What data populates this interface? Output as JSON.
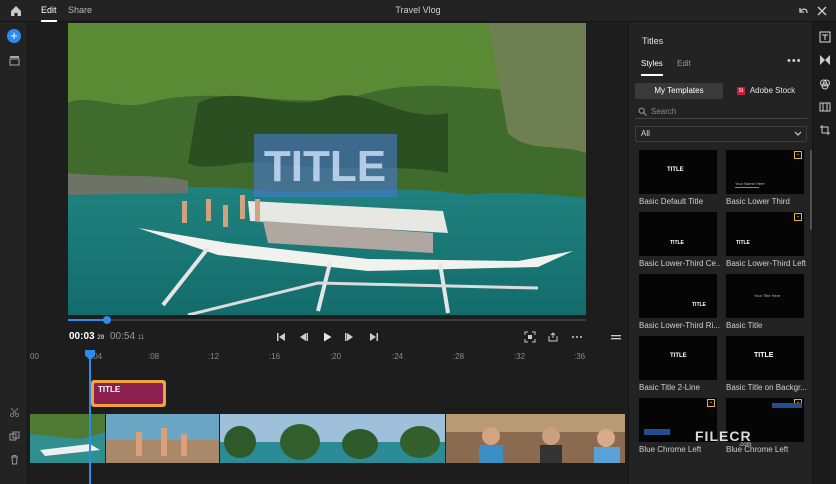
{
  "topbar": {
    "project_title": "Travel Vlog",
    "tabs": {
      "edit": "Edit",
      "share": "Share"
    }
  },
  "preview": {
    "title_overlay": "TITLE"
  },
  "transport": {
    "current_time": "00:03",
    "current_frames": "29",
    "duration": "00:54",
    "duration_frames": "11",
    "playback_progress_percent": 7.5
  },
  "timeline": {
    "ticks": [
      "00",
      ":04",
      ":08",
      ":12",
      ":16",
      ":20",
      ":24",
      ":28",
      ":32",
      ":36"
    ],
    "title_clip_label": "TITLE"
  },
  "panel": {
    "title": "Titles",
    "tabs": {
      "styles": "Styles",
      "edit": "Edit"
    },
    "more": "•••",
    "segments": {
      "my_templates": "My Templates",
      "adobe_stock": "Adobe Stock",
      "stock_icon_text": "St"
    },
    "search_placeholder": "Search",
    "filter_value": "All",
    "templates": [
      {
        "name": "Basic Default Title",
        "preview_text": "TITLE"
      },
      {
        "name": "Basic Lower Third",
        "preview_text": "Your Name Here"
      },
      {
        "name": "Basic Lower-Third Ce...",
        "preview_text": "TITLE"
      },
      {
        "name": "Basic Lower-Third Left",
        "preview_text": "TITLE"
      },
      {
        "name": "Basic Lower-Third Ri...",
        "preview_text": "TITLE"
      },
      {
        "name": "Basic Title",
        "preview_text": "Your Title Here"
      },
      {
        "name": "Basic Title 2-Line",
        "preview_text": "TITLE"
      },
      {
        "name": "Basic Title on Backgr...",
        "preview_text": "TITLE"
      },
      {
        "name": "Blue Chrome Left",
        "preview_text": ""
      },
      {
        "name": "Blue Chrome Left",
        "preview_text": ""
      }
    ]
  },
  "watermark": {
    "text": "FILECR",
    "sub": ".com"
  },
  "colors": {
    "accent": "#2b8cf0",
    "title_clip_border": "#f1a33a",
    "title_clip_fill": "#8b1f4e",
    "premium_badge": "#e4b13a",
    "stock_red": "#c8203c"
  }
}
